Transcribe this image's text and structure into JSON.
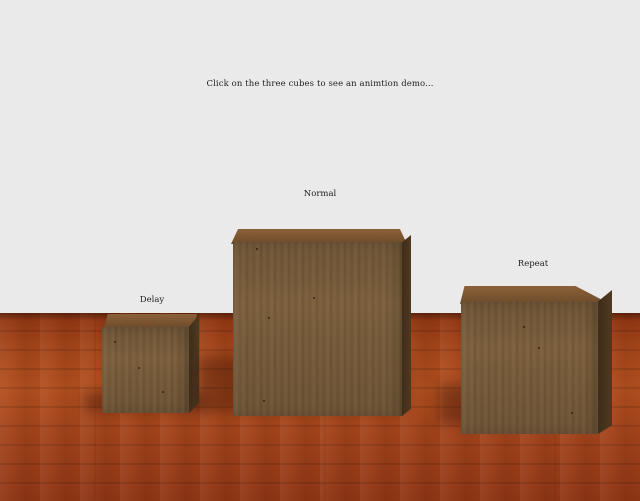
{
  "scene": {
    "instruction": "Click on the three cubes to see an animtion demo..."
  },
  "cubes": [
    {
      "label": "Delay"
    },
    {
      "label": "Normal"
    },
    {
      "label": "Repeat"
    }
  ],
  "colors": {
    "background": "#eaeaea",
    "floor": "#a4451a",
    "cube_wood": "#7a5d3a"
  }
}
